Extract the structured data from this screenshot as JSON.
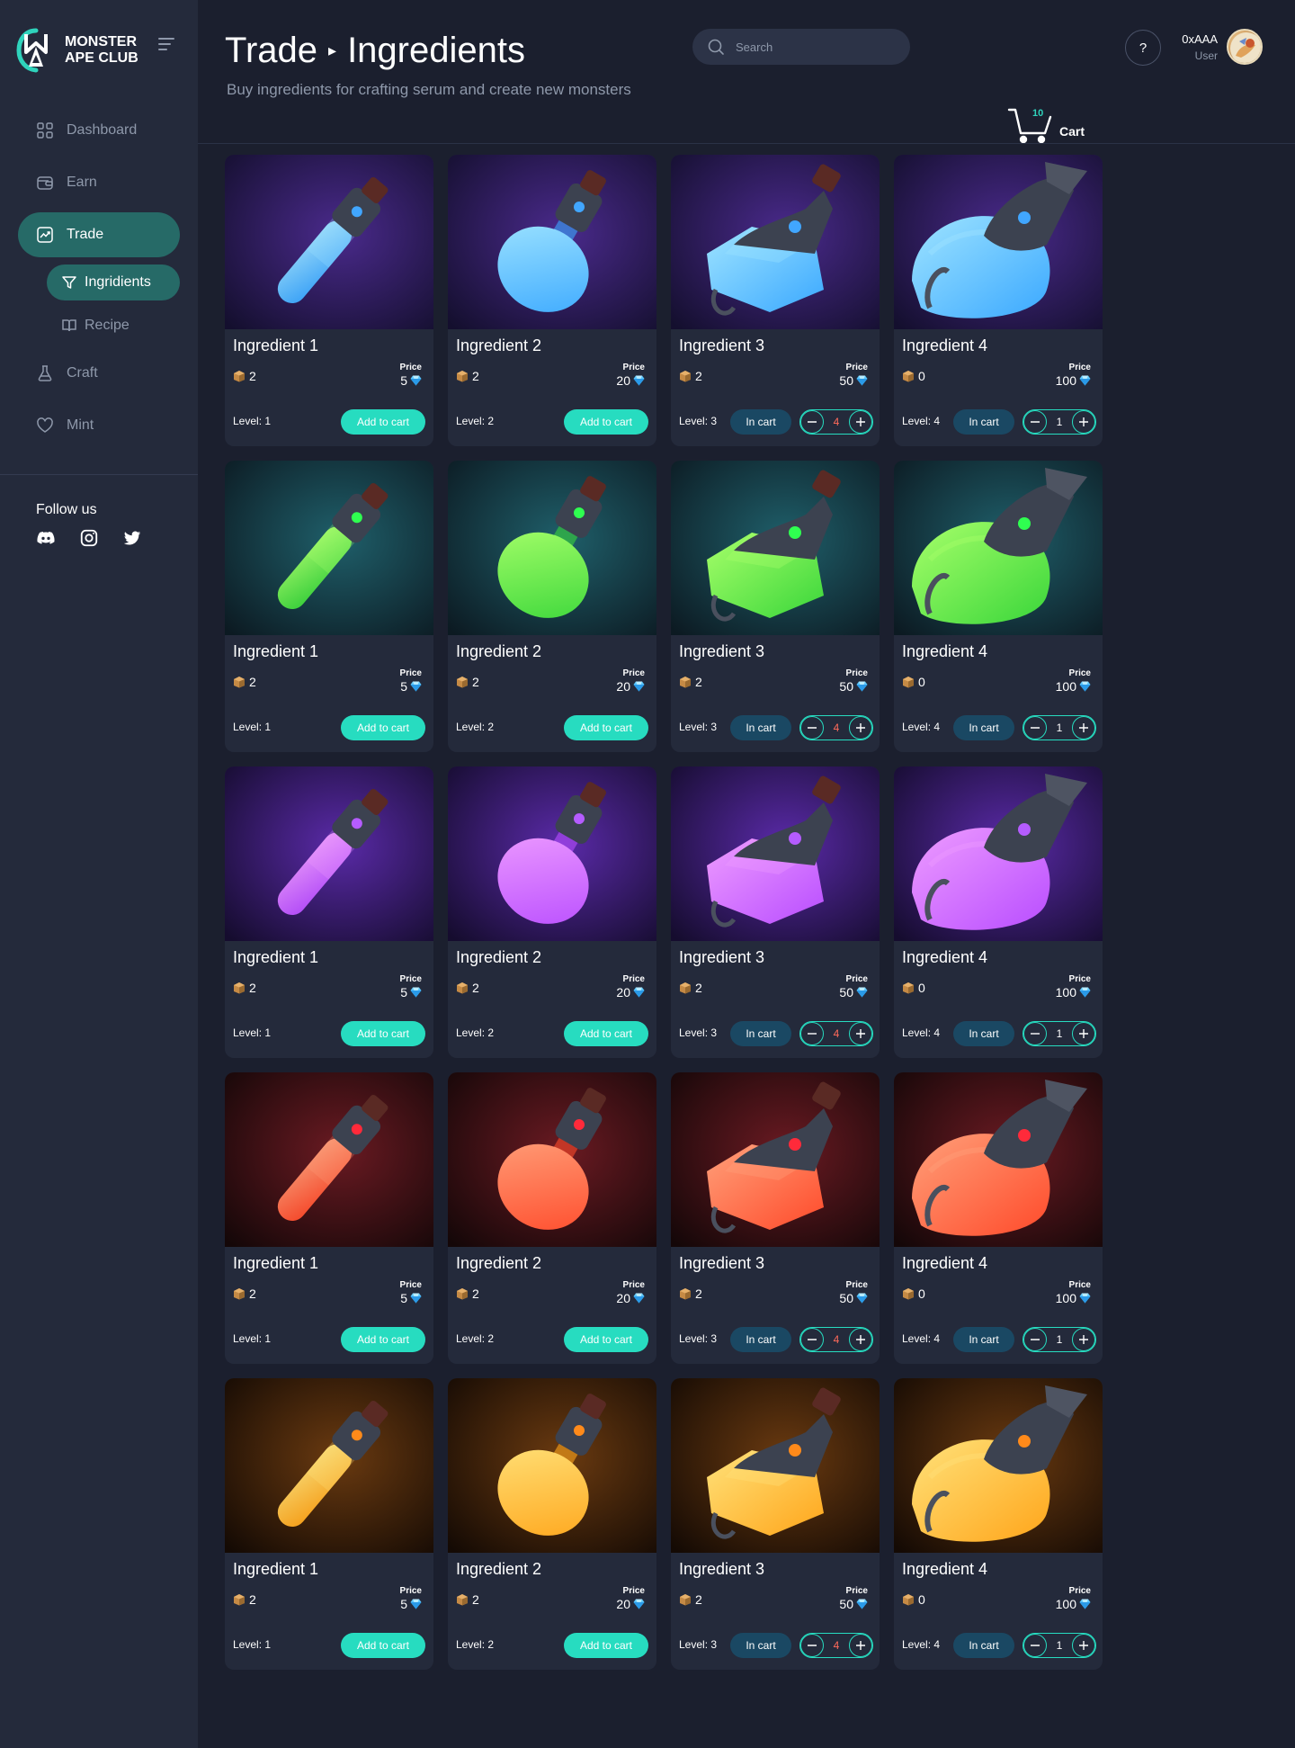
{
  "brand": {
    "line1": "MONSTER",
    "line2": "APE CLUB"
  },
  "nav": {
    "items": [
      {
        "label": "Dashboard",
        "icon": "grid-icon"
      },
      {
        "label": "Earn",
        "icon": "wallet-icon"
      },
      {
        "label": "Trade",
        "icon": "chart-icon"
      }
    ],
    "sub_items": [
      {
        "label": "Ingridients",
        "icon": "filter-icon"
      },
      {
        "label": "Recipe",
        "icon": "book-icon"
      }
    ],
    "items2": [
      {
        "label": "Craft",
        "icon": "flask-icon"
      },
      {
        "label": "Mint",
        "icon": "heart-icon"
      }
    ]
  },
  "follow": {
    "label": "Follow us",
    "icons": [
      "discord-icon",
      "instagram-icon",
      "twitter-icon"
    ]
  },
  "header": {
    "title_part1": "Trade",
    "title_sep": "▸",
    "title_part2": "Ingredients",
    "subtitle": "Buy ingredients for crafting serum and create new monsters",
    "search_placeholder": "Search",
    "help": "?",
    "user_name": "0xAAA",
    "user_role": "User",
    "cart_count": "10",
    "cart_label": "Cart"
  },
  "card_labels": {
    "price": "Price",
    "level_prefix": "Level: ",
    "add": "Add to cart",
    "in_cart": "In cart"
  },
  "colors": {
    "accent": "#27dcc0",
    "active_nav": "#266a67",
    "in_cart_bg": "#1a4863",
    "qty_warn": "#ff6a5a",
    "potion_rows": [
      "#3aa8ff",
      "#39d63a",
      "#b84dff",
      "#ff4a2a",
      "#ffa51a"
    ]
  },
  "rows": [
    {
      "tint": "blue",
      "cards": [
        {
          "name": "Ingredient 1",
          "stock": "2",
          "price": "5",
          "level": "1",
          "in_cart": false,
          "qty": ""
        },
        {
          "name": "Ingredient 2",
          "stock": "2",
          "price": "20",
          "level": "2",
          "in_cart": false,
          "qty": ""
        },
        {
          "name": "Ingredient 3",
          "stock": "2",
          "price": "50",
          "level": "3",
          "in_cart": true,
          "qty": "4"
        },
        {
          "name": "Ingredient 4",
          "stock": "0",
          "price": "100",
          "level": "4",
          "in_cart": true,
          "qty": "1"
        }
      ]
    },
    {
      "tint": "green",
      "cards": [
        {
          "name": "Ingredient 1",
          "stock": "2",
          "price": "5",
          "level": "1",
          "in_cart": false,
          "qty": ""
        },
        {
          "name": "Ingredient 2",
          "stock": "2",
          "price": "20",
          "level": "2",
          "in_cart": false,
          "qty": ""
        },
        {
          "name": "Ingredient 3",
          "stock": "2",
          "price": "50",
          "level": "3",
          "in_cart": true,
          "qty": "4"
        },
        {
          "name": "Ingredient 4",
          "stock": "0",
          "price": "100",
          "level": "4",
          "in_cart": true,
          "qty": "1"
        }
      ]
    },
    {
      "tint": "purple",
      "cards": [
        {
          "name": "Ingredient 1",
          "stock": "2",
          "price": "5",
          "level": "1",
          "in_cart": false,
          "qty": ""
        },
        {
          "name": "Ingredient 2",
          "stock": "2",
          "price": "20",
          "level": "2",
          "in_cart": false,
          "qty": ""
        },
        {
          "name": "Ingredient 3",
          "stock": "2",
          "price": "50",
          "level": "3",
          "in_cart": true,
          "qty": "4"
        },
        {
          "name": "Ingredient 4",
          "stock": "0",
          "price": "100",
          "level": "4",
          "in_cart": true,
          "qty": "1"
        }
      ]
    },
    {
      "tint": "red",
      "cards": [
        {
          "name": "Ingredient 1",
          "stock": "2",
          "price": "5",
          "level": "1",
          "in_cart": false,
          "qty": ""
        },
        {
          "name": "Ingredient 2",
          "stock": "2",
          "price": "20",
          "level": "2",
          "in_cart": false,
          "qty": ""
        },
        {
          "name": "Ingredient 3",
          "stock": "2",
          "price": "50",
          "level": "3",
          "in_cart": true,
          "qty": "4"
        },
        {
          "name": "Ingredient 4",
          "stock": "0",
          "price": "100",
          "level": "4",
          "in_cart": true,
          "qty": "1"
        }
      ]
    },
    {
      "tint": "orange",
      "cards": [
        {
          "name": "Ingredient 1",
          "stock": "2",
          "price": "5",
          "level": "1",
          "in_cart": false,
          "qty": ""
        },
        {
          "name": "Ingredient 2",
          "stock": "2",
          "price": "20",
          "level": "2",
          "in_cart": false,
          "qty": ""
        },
        {
          "name": "Ingredient 3",
          "stock": "2",
          "price": "50",
          "level": "3",
          "in_cart": true,
          "qty": "4"
        },
        {
          "name": "Ingredient 4",
          "stock": "0",
          "price": "100",
          "level": "4",
          "in_cart": true,
          "qty": "1"
        }
      ]
    }
  ]
}
